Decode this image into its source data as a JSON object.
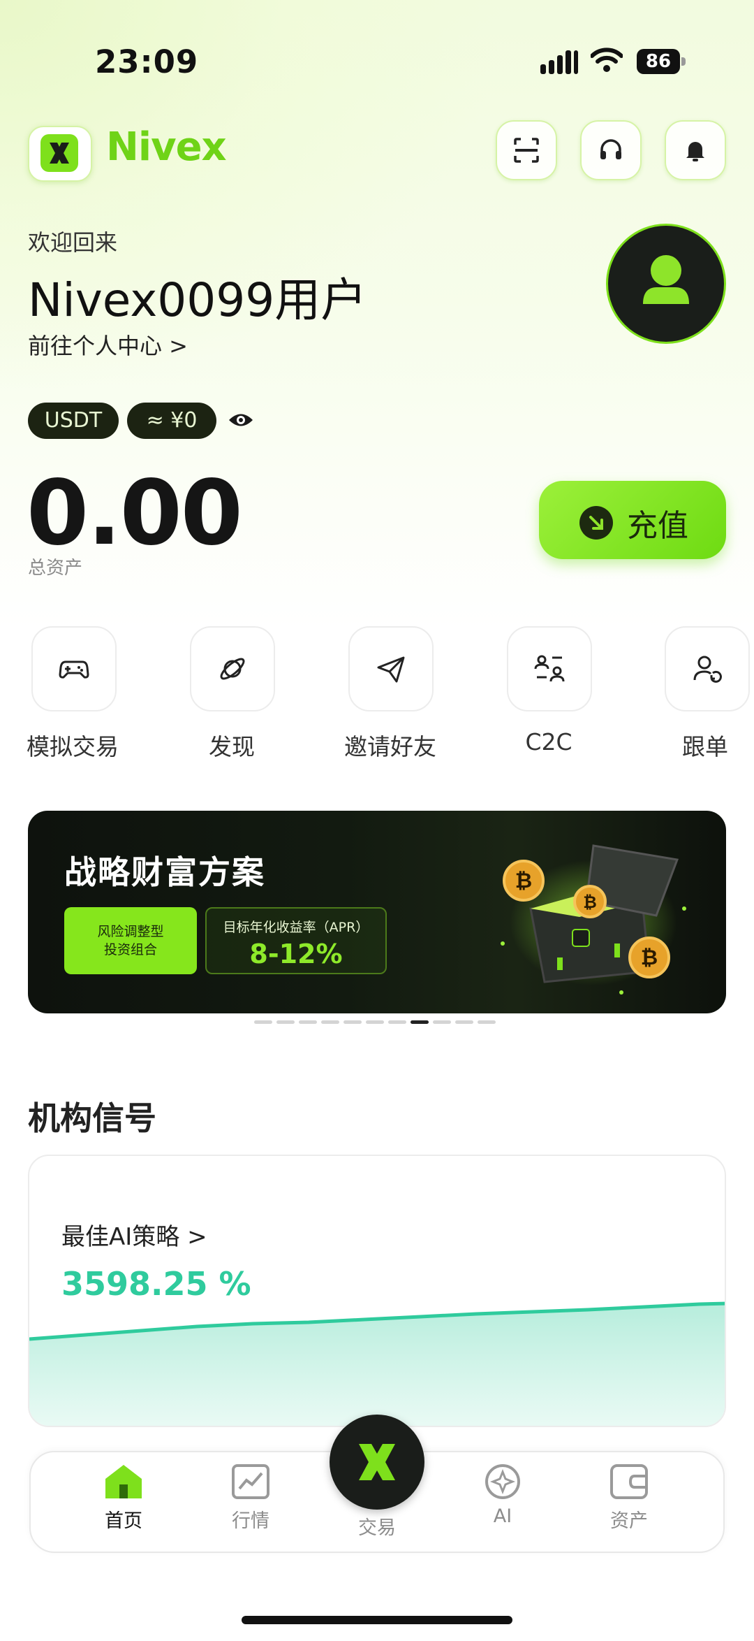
{
  "status_bar": {
    "time": "23:09",
    "battery": "86"
  },
  "header": {
    "logo_text": "Nivex",
    "icons": [
      "scan-icon",
      "headset-icon",
      "bell-icon"
    ]
  },
  "greeting": {
    "welcome": "欢迎回来",
    "username": "Nivex0099用户",
    "profile_link": "前往个人中心 >"
  },
  "balance": {
    "currency": "USDT",
    "fiat_estimate": "≈ ¥0",
    "amount": "0.00",
    "label": "总资产",
    "deposit_label": "充值"
  },
  "quick_actions": [
    {
      "label": "模拟交易",
      "icon": "gamepad-icon"
    },
    {
      "label": "发现",
      "icon": "planet-icon"
    },
    {
      "label": "邀请好友",
      "icon": "send-icon"
    },
    {
      "label": "C2C",
      "icon": "c2c-icon"
    },
    {
      "label": "跟单",
      "icon": "copy-trade-icon"
    }
  ],
  "banner": {
    "title": "战略财富方案",
    "risk_label_1": "风险调整型",
    "risk_label_2": "投资组合",
    "apr_label": "目标年化收益率（APR）",
    "apr_value": "8-12%",
    "page_count": 11,
    "active_page": 8
  },
  "signals": {
    "section_title": "机构信号",
    "card_label": "最佳AI策略 >",
    "card_value": "3598.25 %"
  },
  "bottom_nav": [
    {
      "label": "首页",
      "icon": "home-icon",
      "active": true
    },
    {
      "label": "行情",
      "icon": "chart-icon",
      "active": false
    },
    {
      "label": "交易",
      "icon": "trade-x-icon",
      "active": false
    },
    {
      "label": "AI",
      "icon": "ai-icon",
      "active": false
    },
    {
      "label": "资产",
      "icon": "wallet-icon",
      "active": false
    }
  ],
  "colors": {
    "accent": "#7ee01c",
    "profit": "#2fcb9d",
    "dark": "#1a1d1a"
  }
}
